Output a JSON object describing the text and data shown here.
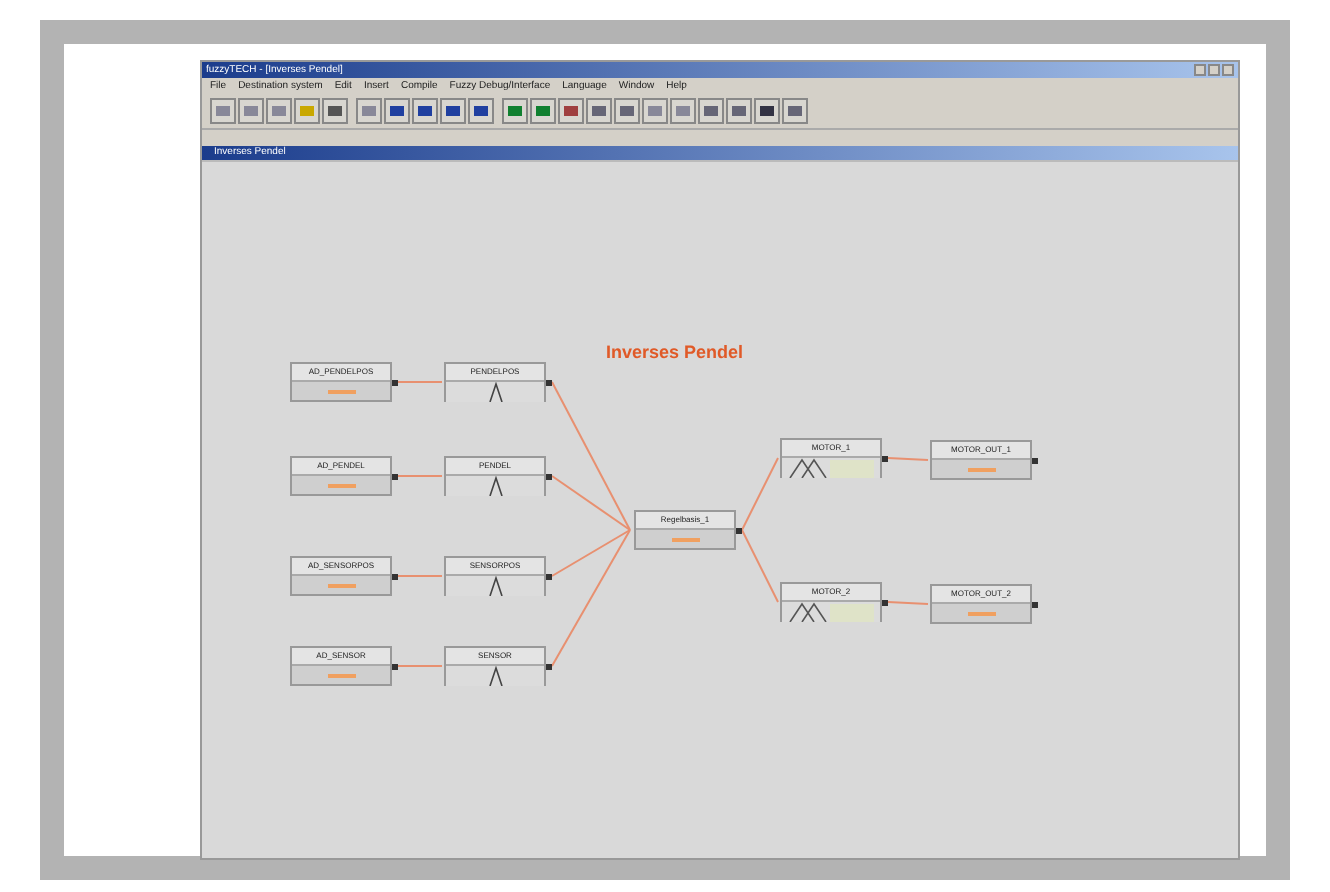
{
  "window": {
    "title": "fuzzyTECH - [Inverses Pendel]"
  },
  "menu": [
    "File",
    "Destination system",
    "Edit",
    "Insert",
    "Compile",
    "Fuzzy Debug/Interface",
    "Language",
    "Window",
    "Help"
  ],
  "document": {
    "title": "Inverses Pendel"
  },
  "diagram": {
    "title": "Inverses Pendel",
    "nodes": [
      {
        "label": "AD_PENDELPOS",
        "kind": "io"
      },
      {
        "label": "PENDELPOS",
        "kind": "variable"
      },
      {
        "label": "AD_PENDEL",
        "kind": "io"
      },
      {
        "label": "PENDEL",
        "kind": "variable"
      },
      {
        "label": "AD_SENSORPOS",
        "kind": "io"
      },
      {
        "label": "SENSORPOS",
        "kind": "variable"
      },
      {
        "label": "AD_SENSOR",
        "kind": "io"
      },
      {
        "label": "SENSOR",
        "kind": "variable"
      },
      {
        "label": "Regelbasis_1",
        "kind": "io"
      },
      {
        "label": "MOTOR_1",
        "kind": "variable"
      },
      {
        "label": "MOTOR_2",
        "kind": "variable"
      },
      {
        "label": "MOTOR_OUT_1",
        "kind": "io"
      },
      {
        "label": "MOTOR_OUT_2",
        "kind": "io"
      }
    ]
  }
}
